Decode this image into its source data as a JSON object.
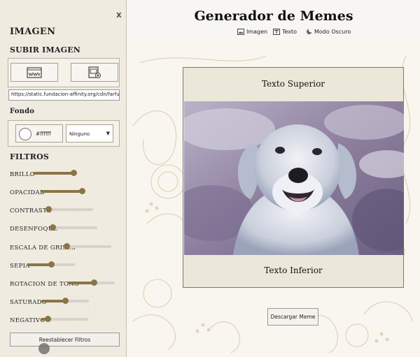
{
  "header": {
    "title": "Generador de Memes",
    "nav": [
      {
        "label": "Imagen",
        "icon": "image-icon"
      },
      {
        "label": "Texto",
        "icon": "text-icon"
      },
      {
        "label": "Modo Oscuro",
        "icon": "dark-mode-icon"
      }
    ]
  },
  "sidebar": {
    "close_label": "x",
    "title": "IMAGEN",
    "upload_title": "SUBIR IMAGEN",
    "upload_buttons": [
      {
        "icon": "url-upload-icon"
      },
      {
        "icon": "file-upload-icon"
      }
    ],
    "url_value": "https://static.fundacion-affinity.org/cdn/farfuture/F",
    "fondo_label": "Fondo",
    "color_value": "#ffffff",
    "blend_select": "Ninguno",
    "filters_title": "FILTROS",
    "filters": [
      {
        "label": "BRILLO",
        "value": 1.0
      },
      {
        "label": "OPACIDAD",
        "value": 1.0
      },
      {
        "label": "CONTRASTE",
        "value": 0.0
      },
      {
        "label": "DESENFOQUE",
        "value": 0.0
      },
      {
        "label": "ESCALA DE GRISES",
        "value": 0.0
      },
      {
        "label": "SEPIA",
        "value": 0.5
      },
      {
        "label": "ROTACION DE TONO",
        "value": 0.57
      },
      {
        "label": "SATURADO",
        "value": 0.5
      },
      {
        "label": "NEGATIVO",
        "value": 0.11
      }
    ],
    "reset_label": "Reestablecer Filtros"
  },
  "meme": {
    "top_text": "Texto Superior",
    "bottom_text": "Texto Inferior",
    "image_subject": "golden retriever dog"
  },
  "download_label": "Descargar Meme",
  "colors": {
    "accent": "#8a7548",
    "sidebar_bg": "#eee9df",
    "meme_bg": "#ece8d9",
    "floral": "#d8cba3"
  }
}
